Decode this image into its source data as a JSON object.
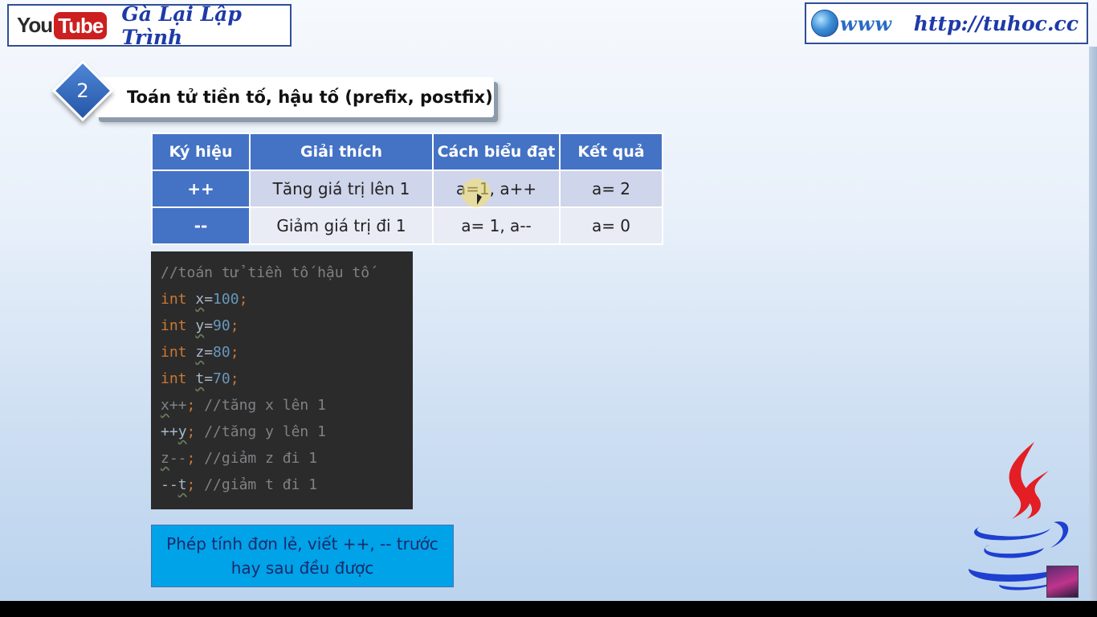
{
  "header": {
    "youtube_you": "You",
    "youtube_tube": "Tube",
    "channel_name": "Gà Lại Lập Trình",
    "www_label": "www",
    "site_url": "http://tuhoc.cc"
  },
  "section": {
    "number": "2",
    "title": "Toán tử tiền tố, hậu tố (prefix, postfix)"
  },
  "table": {
    "headers": [
      "Ký hiệu",
      "Giải thích",
      "Cách biểu đạt",
      "Kết quả"
    ],
    "rows": [
      {
        "symbol": "++",
        "explain": "Tăng giá trị lên 1",
        "expr": "a=1, a++",
        "result": "a= 2"
      },
      {
        "symbol": "--",
        "explain": "Giảm giá trị đi 1",
        "expr": "a= 1, a--",
        "result": "a= 0"
      }
    ]
  },
  "code": {
    "comment_header": "//toán tử tiền tố hậu tố",
    "kw_int": "int",
    "decls": [
      {
        "name": "x",
        "value": "100"
      },
      {
        "name": "y",
        "value": "90"
      },
      {
        "name": "z",
        "value": "80"
      },
      {
        "name": "t",
        "value": "70"
      }
    ],
    "ops": [
      {
        "pre": "",
        "var": "x",
        "post": "++",
        "comment": "//tăng x lên 1"
      },
      {
        "pre": "++",
        "var": "y",
        "post": "",
        "comment": "//tăng y lên 1"
      },
      {
        "pre": "",
        "var": "z",
        "post": "--",
        "comment": "//giảm z đi 1"
      },
      {
        "pre": "--",
        "var": "t",
        "post": "",
        "comment": "//giảm t đi 1"
      }
    ]
  },
  "note": {
    "line1": "Phép tính đơn lẻ, viết ++, -- trước",
    "line2": "hay sau đều được"
  },
  "colors": {
    "header_blue": "#4472c4",
    "row1": "#cfd5ea",
    "row2": "#e9ebf5",
    "note_bg": "#00a2e8",
    "code_bg": "#2b2b2b",
    "java_red": "#e31e24",
    "java_blue": "#1e3fd0"
  }
}
